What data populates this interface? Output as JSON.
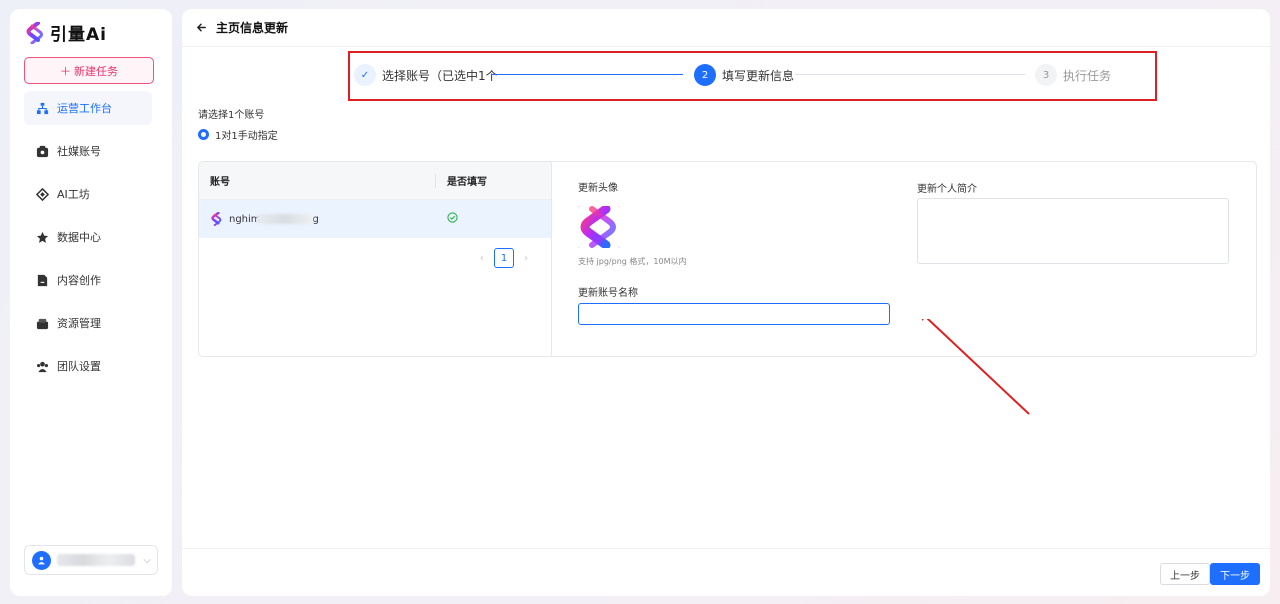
{
  "app": {
    "logo_text": "引量Ai"
  },
  "sidebar": {
    "new_task_label": "新建任务",
    "items": [
      {
        "label": "运营工作台",
        "icon": "workbench-icon",
        "active": true
      },
      {
        "label": "社媒账号",
        "icon": "social-account-icon"
      },
      {
        "label": "AI工坊",
        "icon": "ai-workshop-icon"
      },
      {
        "label": "数据中心",
        "icon": "data-center-icon"
      },
      {
        "label": "内容创作",
        "icon": "content-creation-icon"
      },
      {
        "label": "资源管理",
        "icon": "resource-icon"
      },
      {
        "label": "团队设置",
        "icon": "team-icon"
      }
    ]
  },
  "header": {
    "title": "主页信息更新"
  },
  "steps": [
    {
      "num": "✓",
      "label": "选择账号（已选中1个",
      "state": "done"
    },
    {
      "num": "2",
      "label": "填写更新信息",
      "state": "active"
    },
    {
      "num": "3",
      "label": "执行任务",
      "state": "pending"
    }
  ],
  "selection": {
    "prompt": "请选择1个账号",
    "option_label": "1对1手动指定"
  },
  "table": {
    "col_account": "账号",
    "col_filled": "是否填写",
    "rows": [
      {
        "account": "nghim",
        "account_suffix": "g",
        "filled": true
      }
    ],
    "page": "1"
  },
  "form": {
    "avatar_label": "更新头像",
    "avatar_hint": "支持 jpg/png 格式，10M以内",
    "name_label": "更新账号名称",
    "name_value": "",
    "bio_label": "更新个人简介",
    "bio_value": ""
  },
  "footer": {
    "prev_label": "上一步",
    "next_label": "下一步"
  },
  "colors": {
    "accent": "#1e6fff",
    "brand": "#e8336a",
    "highlight_box": "#e02020"
  }
}
